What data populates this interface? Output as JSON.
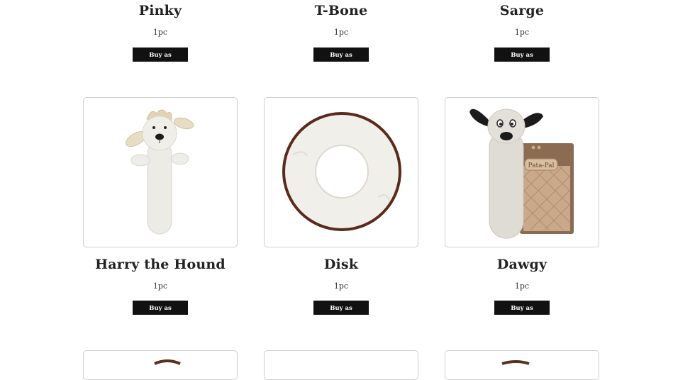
{
  "products": [
    {
      "name": "Pinky",
      "quantity": "1pc",
      "button_label": "Buy as Retailer"
    },
    {
      "name": "T-Bone",
      "quantity": "1pc",
      "button_label": "Buy as Retailer"
    },
    {
      "name": "Sarge",
      "quantity": "1pc",
      "button_label": "Buy as Retailer"
    },
    {
      "name": "Harry the Hound",
      "quantity": "1pc",
      "button_label": "Buy as Retailer",
      "image_icon": "plush-dog-stick-image"
    },
    {
      "name": "Disk",
      "quantity": "1pc",
      "button_label": "Buy as Retailer",
      "image_icon": "plush-ring-disk-image"
    },
    {
      "name": "Dawgy",
      "quantity": "1pc",
      "button_label": "Buy as Retailer",
      "image_icon": "plush-dog-with-package-image"
    }
  ],
  "package_brand": "Pata-Pal",
  "colors": {
    "button_bg": "#111111",
    "button_text": "#ffffff",
    "card_border": "#cfcfcf",
    "text": "#222222"
  }
}
